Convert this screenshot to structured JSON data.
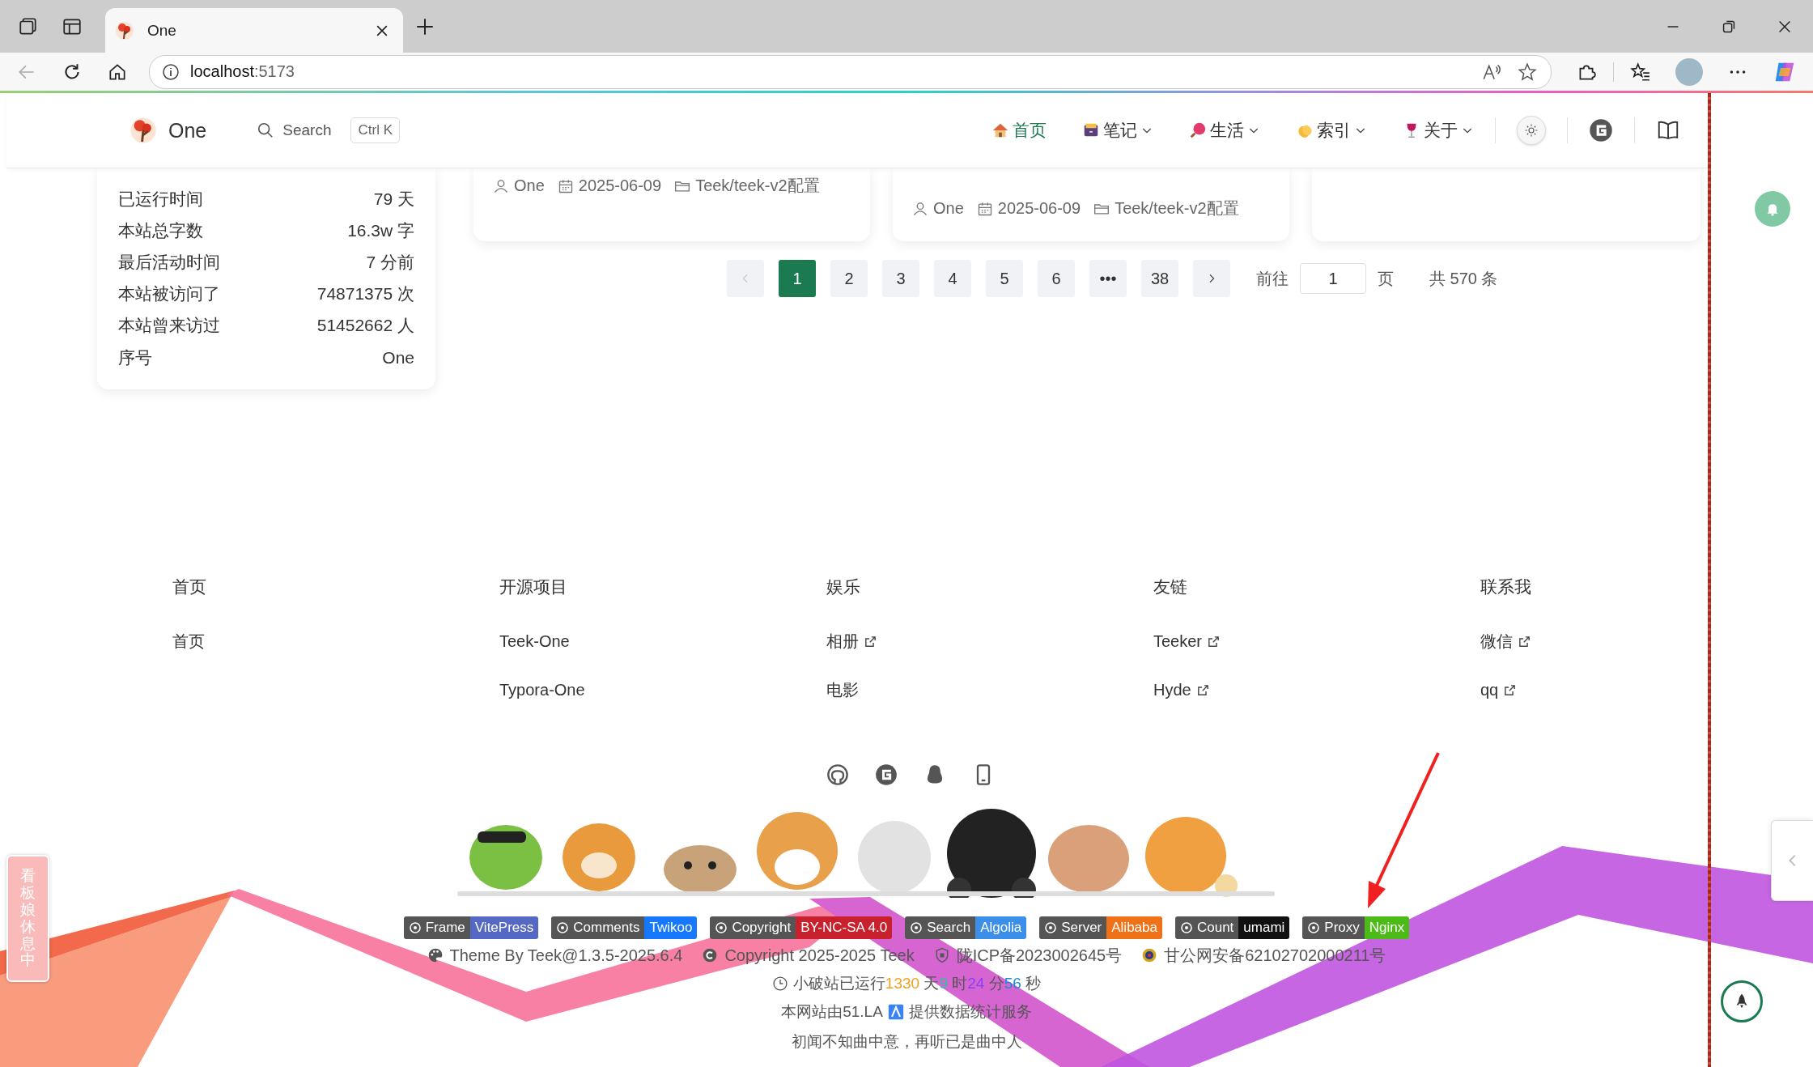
{
  "browser": {
    "tabs": [
      {
        "title": "One",
        "selected": true
      }
    ],
    "address": {
      "host": "localhost",
      "port": ":5173"
    }
  },
  "nav": {
    "logo": "One",
    "search": {
      "placeholder": "Search",
      "shortcut": "Ctrl K"
    },
    "items": [
      {
        "label": "首页",
        "selected": true,
        "dropdown": false
      },
      {
        "label": "笔记",
        "selected": false,
        "dropdown": true
      },
      {
        "label": "生活",
        "selected": false,
        "dropdown": true
      },
      {
        "label": "索引",
        "selected": false,
        "dropdown": true
      },
      {
        "label": "关于",
        "selected": false,
        "dropdown": true
      }
    ]
  },
  "stats": [
    {
      "label": "已运行时间",
      "value": "79 天"
    },
    {
      "label": "本站总字数",
      "value": "16.3w 字"
    },
    {
      "label": "最后活动时间",
      "value": "7 分前"
    },
    {
      "label": "本站被访问了",
      "value": "74871375 次"
    },
    {
      "label": "本站曾来访过",
      "value": "51452662 人"
    },
    {
      "label": "序号",
      "value": "One"
    }
  ],
  "posts": [
    {
      "kind": "meta",
      "author": "One",
      "date": "2025-06-09",
      "category": "Teek/teek-v2配置"
    },
    {
      "kind": "meta",
      "author": "One",
      "date": "2025-06-09",
      "category": "Teek/teek-v2配置"
    },
    {
      "kind": "blank"
    }
  ],
  "pagination": {
    "prev": {
      "disabled": true
    },
    "next": {
      "disabled": false
    },
    "pages": [
      {
        "label": "1",
        "selected": true
      },
      {
        "label": "2",
        "selected": false
      },
      {
        "label": "3",
        "selected": false
      },
      {
        "label": "4",
        "selected": false
      },
      {
        "label": "5",
        "selected": false
      },
      {
        "label": "6",
        "selected": false
      },
      {
        "label": "•••",
        "selected": false
      },
      {
        "label": "38",
        "selected": false
      }
    ],
    "goto_label": "前往",
    "goto_value": "1",
    "page_unit": "页",
    "total": "共 570 条"
  },
  "footer": {
    "columns": [
      {
        "title": "首页",
        "links": [
          {
            "label": "首页",
            "external": false
          }
        ]
      },
      {
        "title": "开源项目",
        "links": [
          {
            "label": "Teek-One",
            "external": false
          },
          {
            "label": "Typora-One",
            "external": false
          }
        ]
      },
      {
        "title": "娱乐",
        "links": [
          {
            "label": "相册",
            "external": true
          },
          {
            "label": "电影",
            "external": false
          }
        ]
      },
      {
        "title": "友链",
        "links": [
          {
            "label": "Teeker",
            "external": true
          },
          {
            "label": "Hyde",
            "external": true
          }
        ]
      },
      {
        "title": "联系我",
        "links": [
          {
            "label": "微信",
            "external": true
          },
          {
            "label": "qq",
            "external": true
          }
        ]
      }
    ],
    "badges": [
      {
        "label": "Frame",
        "value": "VitePress",
        "color": "#5468c4"
      },
      {
        "label": "Comments",
        "value": "Twikoo",
        "color": "#1677ff"
      },
      {
        "label": "Copyright",
        "value": "BY-NC-SA 4.0",
        "color": "#c8202c"
      },
      {
        "label": "Search",
        "value": "Algolia",
        "color": "#3c8fe8"
      },
      {
        "label": "Server",
        "value": "Alibaba",
        "color": "#f07218"
      },
      {
        "label": "Count",
        "value": "umami",
        "color": "#111111"
      },
      {
        "label": "Proxy",
        "value": "Nginx",
        "color": "#4cbb17"
      }
    ],
    "info": [
      "Theme By Teek@1.3.5-2025.6.4",
      "Copyright 2025-2025 Teek",
      "陇ICP备2023002645号",
      "甘公网安备62102702000211号"
    ],
    "uptime": {
      "prefix": "小破站已运行",
      "parts": [
        {
          "value": "1330",
          "unit": "天",
          "color": "#f0a020"
        },
        {
          "value": "9",
          "unit": "时",
          "color": "#2bc3a0"
        },
        {
          "value": "24",
          "unit": "分",
          "color": "#8a3ff0"
        },
        {
          "value": "56",
          "unit": "秒",
          "color": "#1a8ad6"
        }
      ]
    },
    "analytics": {
      "before": "本网站由51.LA",
      "after": "提供数据统计服务"
    },
    "motto": "初闻不知曲中意，再听已是曲中人"
  },
  "mascot_tab": "看板娘休息中"
}
